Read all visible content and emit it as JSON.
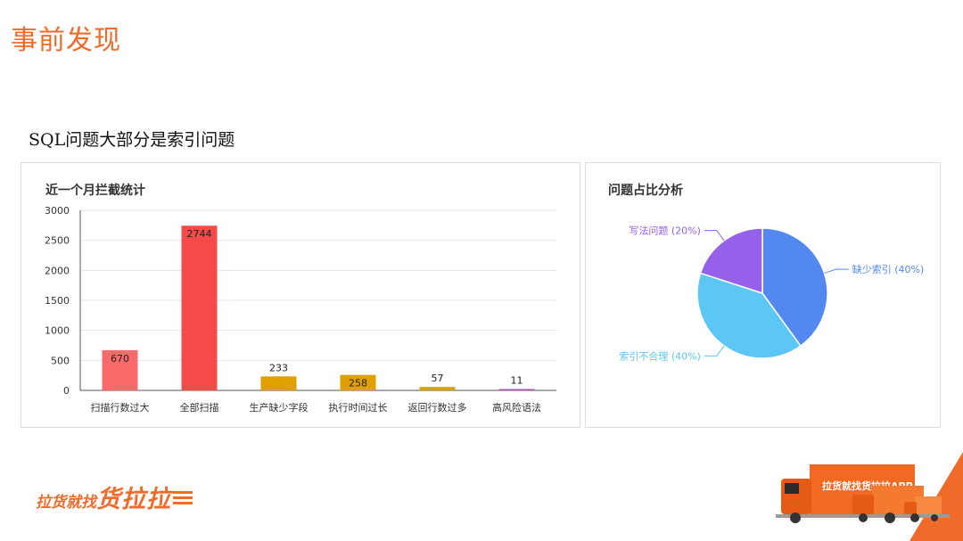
{
  "slide": {
    "title": "事前发现",
    "subtitle": "SQL问题大部分是索引问题"
  },
  "bar_panel": {
    "title": "近一个月拦截统计"
  },
  "pie_panel": {
    "title": "问题占比分析"
  },
  "logo": {
    "small_text": "拉货就找",
    "big_text": "货拉拉"
  },
  "truck": {
    "text": "拉货就找货拉拉APP"
  },
  "colors": {
    "brand": "#f06b2a"
  },
  "chart_data": [
    {
      "type": "bar",
      "title": "近一个月拦截统计",
      "categories": [
        "扫描行数过大",
        "全部扫描",
        "生产缺少字段",
        "执行时间过长",
        "返回行数过多",
        "高风险语法"
      ],
      "values": [
        670,
        2744,
        233,
        258,
        57,
        11
      ],
      "colors": [
        "#f96b6b",
        "#f44a4a",
        "#e0a100",
        "#e0a100",
        "#e0a100",
        "#e03ab0"
      ],
      "ylim": [
        0,
        3000
      ],
      "yticks": [
        0,
        500,
        1000,
        1500,
        2000,
        2500,
        3000
      ],
      "grid": true
    },
    {
      "type": "pie",
      "title": "问题占比分析",
      "slices": [
        {
          "label": "缺少索引 (40%)",
          "value": 40,
          "color": "#5388f0"
        },
        {
          "label": "索引不合理 (40%)",
          "value": 40,
          "color": "#5cc6f4"
        },
        {
          "label": "写法问题 (20%)",
          "value": 20,
          "color": "#9560ea"
        }
      ]
    }
  ]
}
